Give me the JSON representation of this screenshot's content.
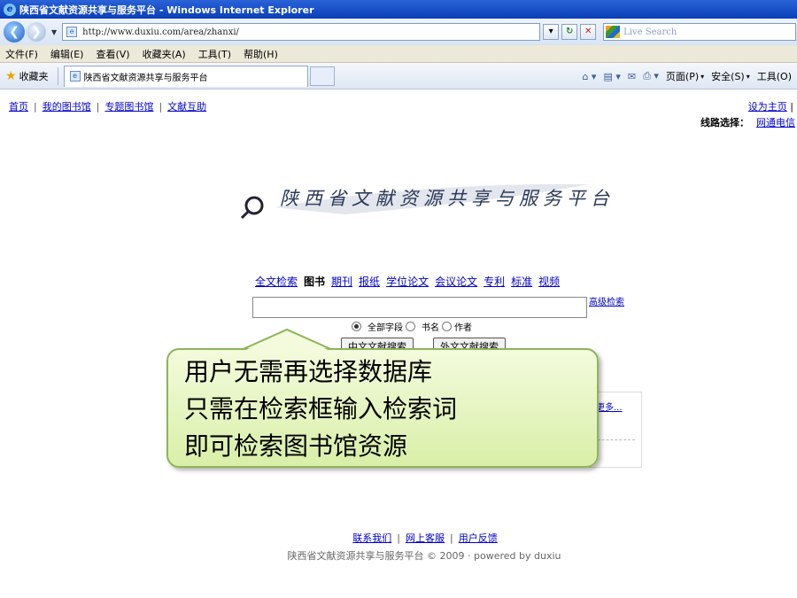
{
  "window": {
    "title": "陕西省文献资源共享与服务平台 - Windows Internet Explorer"
  },
  "address": {
    "url": "http://www.duxiu.com/area/zhanxi/",
    "search_placeholder": "Live Search"
  },
  "menu": [
    "文件(F)",
    "编辑(E)",
    "查看(V)",
    "收藏夹(A)",
    "工具(T)",
    "帮助(H)"
  ],
  "favbar": {
    "favorites_label": "收藏夹",
    "tab_title": "陕西省文献资源共享与服务平台",
    "tools": [
      "页面(P)",
      "安全(S)",
      "工具(O)"
    ]
  },
  "page": {
    "top_links": [
      "首页",
      "我的图书馆",
      "专题图书馆",
      "文献互助"
    ],
    "set_home": "设为主页",
    "line_select_label": "线路选择：",
    "line_select_value": "网通电信",
    "logo_text": "陕西省文献资源共享与服务平台",
    "categories": [
      "全文检索",
      "图书",
      "期刊",
      "报纸",
      "学位论文",
      "会议论文",
      "专利",
      "标准",
      "视频"
    ],
    "current_category": "图书",
    "advanced_search": "高级检索",
    "radio_options": [
      "全部字段",
      "书名",
      "作者"
    ],
    "btn_cn": "中文文献搜索",
    "btn_foreign": "外文文献搜索",
    "more": "更多...",
    "footer_links": [
      "联系我们",
      "网上客服",
      "用户反馈"
    ],
    "copyright": "陕西省文献资源共享与服务平台 © 2009 · powered by duxiu"
  },
  "callout": {
    "lines": [
      "用户无需再选择数据库",
      "只需在检索框输入检索词",
      "即可检索图书馆资源"
    ]
  }
}
